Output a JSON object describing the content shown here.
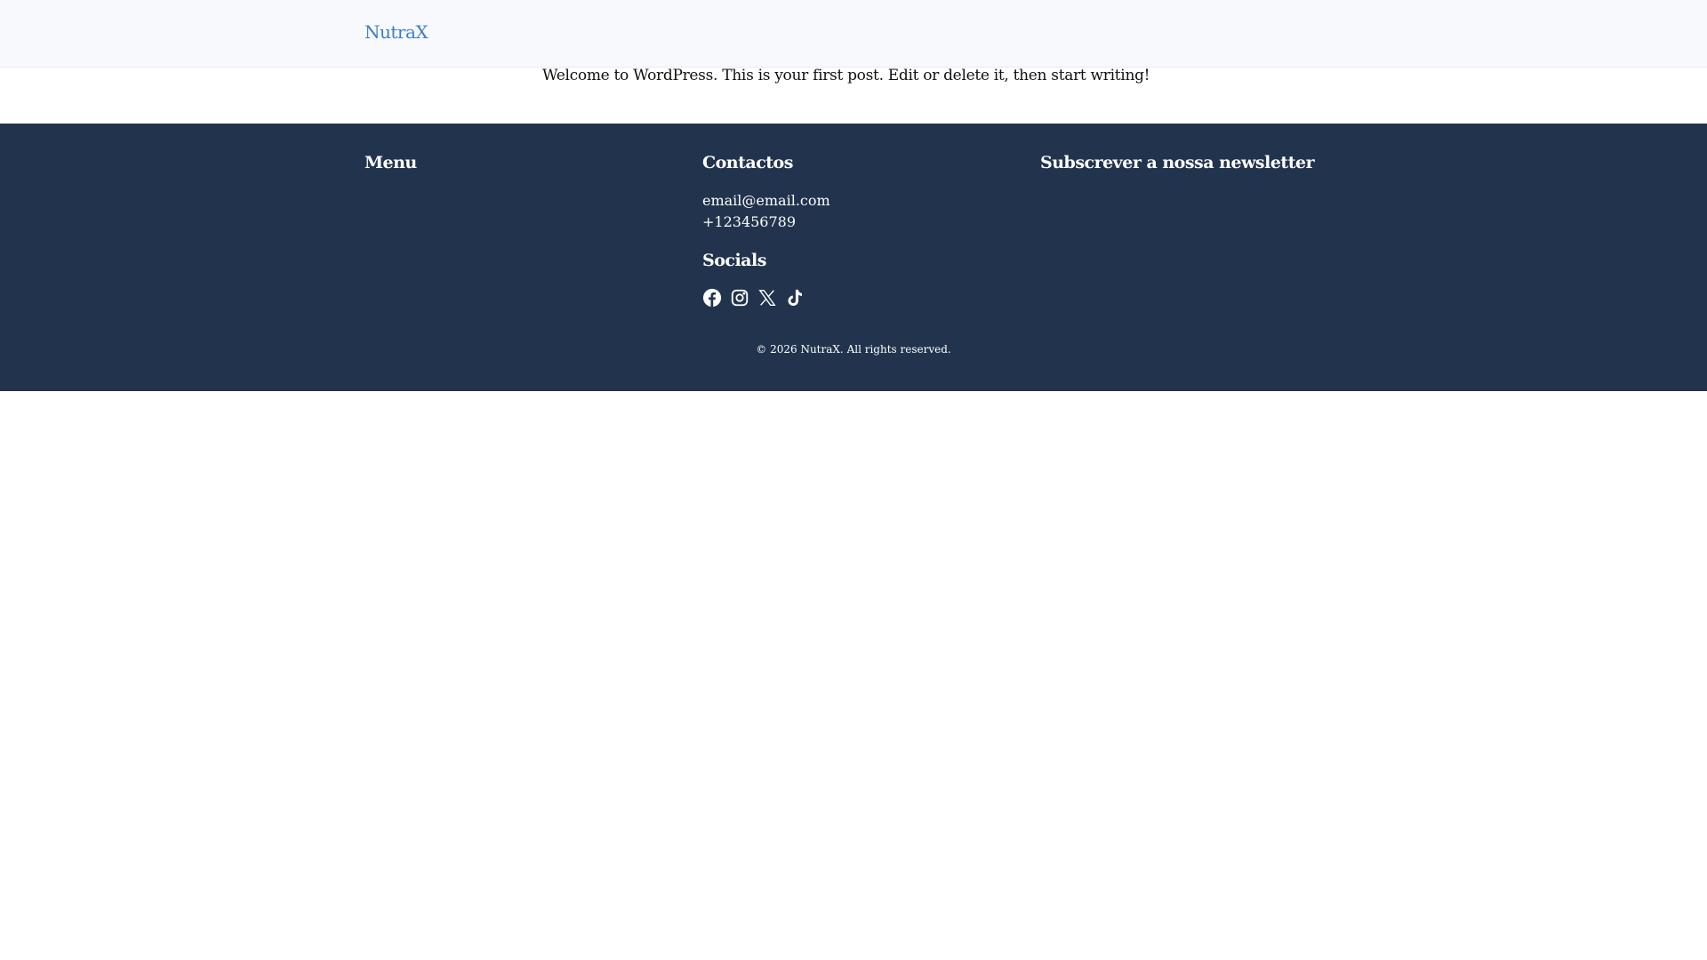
{
  "header": {
    "logo": "NutraX"
  },
  "main": {
    "post_text": "Welcome to WordPress. This is your first post. Edit or delete it, then start writing!"
  },
  "footer": {
    "menu_heading": "Menu",
    "contacts_heading": "Contactos",
    "email": "email@email.com",
    "phone": "+123456789",
    "socials_heading": "Socials",
    "socials": [
      "facebook-icon",
      "instagram-icon",
      "x-icon",
      "tiktok-icon"
    ],
    "newsletter_heading": "Subscrever a nossa newsletter",
    "copyright": "© 2026 NutraX. All rights reserved."
  },
  "colors": {
    "brand": "#3d7fc1",
    "footer_bg": "#22334d",
    "header_bg": "#f7f9fd"
  }
}
